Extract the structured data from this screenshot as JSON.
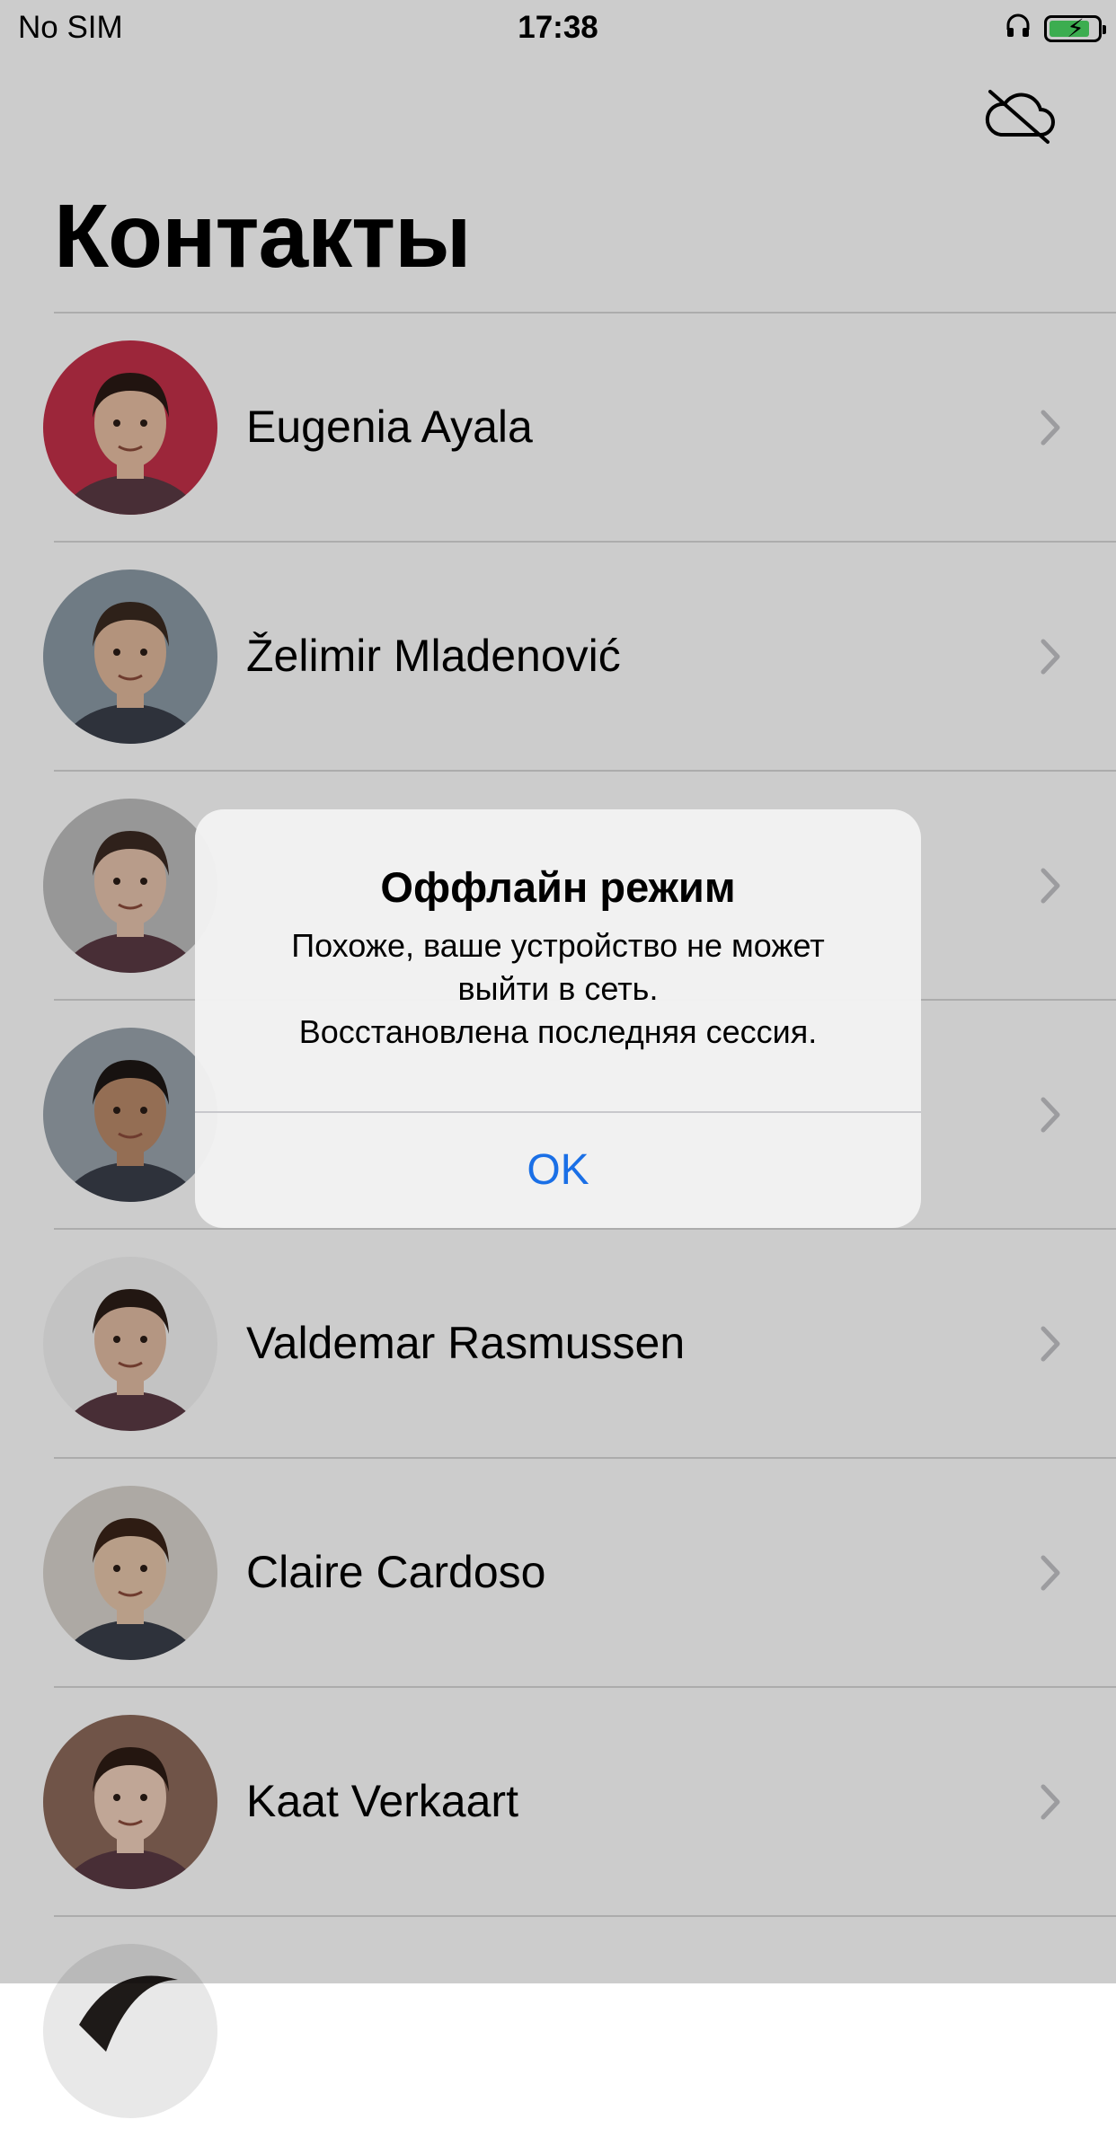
{
  "status_bar": {
    "carrier": "No SIM",
    "time": "17:38",
    "battery_level": 0.85
  },
  "nav": {
    "title": "Контакты",
    "offline_icon": "cloud-slash-icon"
  },
  "contacts": [
    {
      "name": "Eugenia Ayala",
      "avatar_bg": "#c43049",
      "skin": "#e8bfa3",
      "hair": "#2a1a14"
    },
    {
      "name": "Želimir Mladenović",
      "avatar_bg": "#8b9aa6",
      "skin": "#e0b89c",
      "hair": "#3a2a20"
    },
    {
      "name": "",
      "avatar_bg": "#bdbdbd",
      "skin": "#e6c3ad",
      "hair": "#3b2a22"
    },
    {
      "name": "",
      "avatar_bg": "#9aa4ad",
      "skin": "#b98a6a",
      "hair": "#1d1715"
    },
    {
      "name": "Valdemar Rasmussen",
      "avatar_bg": "#f4f4f4",
      "skin": "#e2bca3",
      "hair": "#2b1d17"
    },
    {
      "name": "Claire Cardoso",
      "avatar_bg": "#d9d4cd",
      "skin": "#e7c6aa",
      "hair": "#3a2418"
    },
    {
      "name": "Kaat Verkaart",
      "avatar_bg": "#8c6a5b",
      "skin": "#f0d0bc",
      "hair": "#2e1c14"
    }
  ],
  "alert": {
    "title": "Оффлайн режим",
    "message_lines": [
      "Похоже, ваше устройство не может",
      "выйти в сеть.",
      "Восстановлена последняя сессия."
    ],
    "ok_label": "OK"
  },
  "colors": {
    "accent": "#1a6fe6",
    "battery": "#4cd964"
  }
}
